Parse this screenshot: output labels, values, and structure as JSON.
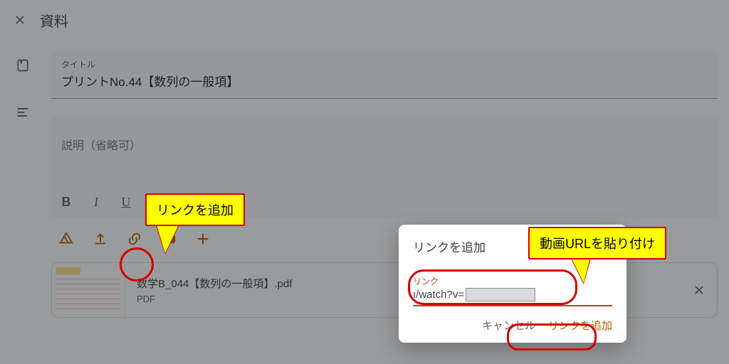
{
  "header": {
    "title": "資料"
  },
  "form": {
    "title_label": "タイトル",
    "title_value": "プリントNo.44【数列の一般項】",
    "description_placeholder": "説明（省略可）"
  },
  "attachment": {
    "filename": "数学B_044【数列の一般項】.pdf",
    "filetype": "PDF"
  },
  "dialog": {
    "heading": "リンクを追加",
    "field_label": "リンク",
    "field_value_prefix": "ı/watch?v=",
    "cancel": "キャンセル",
    "confirm": "リンクを追加"
  },
  "callouts": {
    "add_link": "リンクを追加",
    "paste_url": "動画URLを貼り付け"
  },
  "colors": {
    "accent": "#b06000",
    "annotation": "#d40000",
    "callout_bg": "#ffff00"
  }
}
